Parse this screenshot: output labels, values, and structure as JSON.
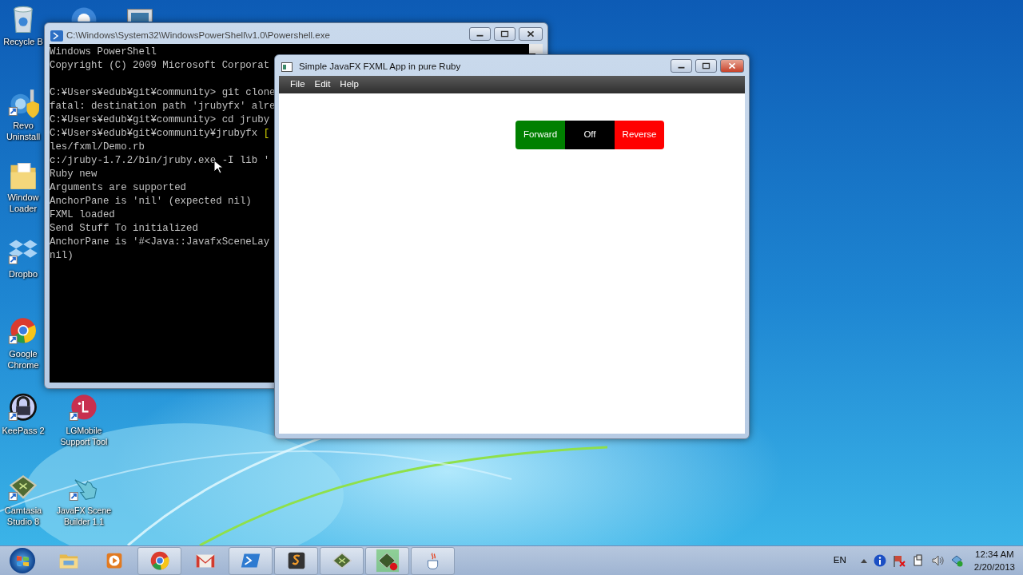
{
  "desktop_icons": [
    {
      "kind": "recycle",
      "label": "Recycle B"
    },
    {
      "kind": "revo",
      "label": "Revo Uninstall"
    },
    {
      "kind": "folder",
      "label": "Window Loader"
    },
    {
      "kind": "dropbox",
      "label": "Dropbo"
    },
    {
      "kind": "chrome",
      "label": "Google Chrome"
    },
    {
      "kind": "keepass",
      "label": "KeePass 2"
    },
    {
      "kind": "camtasia",
      "label": "Camtasia Studio 8"
    },
    {
      "kind": "ie"
    },
    {
      "kind": "lg",
      "label": "LGMobile Support Tool"
    },
    {
      "kind": "hand",
      "label": "JavaFX Scene Builder 1.1"
    },
    {
      "kind": "monitor"
    }
  ],
  "console_window": {
    "title": "C:\\Windows\\System32\\WindowsPowerShell\\v1.0\\Powershell.exe",
    "lines": [
      {
        "text": "Windows PowerShell"
      },
      {
        "text": "Copyright (C) 2009 Microsoft Corporat"
      },
      {
        "text": "C:¥Users¥edub¥git¥community> git clone",
        "blank_before": true
      },
      {
        "text": "fatal: destination path 'jrubyfx' alre"
      },
      {
        "text": "C:¥Users¥edub¥git¥community> cd jruby"
      },
      {
        "text": "C:¥Users¥edub¥git¥community¥jrubyfx",
        "tail": "["
      },
      {
        "text": "les/fxml/Demo.rb"
      },
      {
        "text": "c:/jruby-1.7.2/bin/jruby.exe -I lib '"
      },
      {
        "text": "Ruby new"
      },
      {
        "text": "Arguments are supported"
      },
      {
        "text": "AnchorPane is 'nil' (expected nil)"
      },
      {
        "text": "FXML loaded"
      },
      {
        "text": "Send Stuff To initialized"
      },
      {
        "text": "AnchorPane is '#<Java::JavafxSceneLay"
      },
      {
        "text": "nil)"
      }
    ]
  },
  "app_window": {
    "title": "Simple JavaFX FXML App in pure Ruby",
    "menu": [
      "File",
      "Edit",
      "Help"
    ],
    "segments": [
      {
        "label": "Forward",
        "color": "#008000"
      },
      {
        "label": "Off",
        "color": "#000000"
      },
      {
        "label": "Reverse",
        "color": "#ff0000"
      }
    ]
  },
  "taskbar": {
    "items": [
      {
        "kind": "explorer",
        "running": false
      },
      {
        "kind": "media",
        "running": false
      },
      {
        "kind": "chrome",
        "running": true
      },
      {
        "kind": "gmail",
        "running": false
      },
      {
        "kind": "powershell",
        "running": true
      },
      {
        "kind": "sublime",
        "running": true
      },
      {
        "kind": "camtasia",
        "running": true
      },
      {
        "kind": "recorder",
        "running": true
      },
      {
        "kind": "java",
        "running": true
      }
    ],
    "language": "EN",
    "tray": [
      {
        "kind": "info"
      },
      {
        "kind": "flag"
      },
      {
        "kind": "device"
      },
      {
        "kind": "volume"
      },
      {
        "kind": "network"
      }
    ],
    "time": "12:34 AM",
    "date": "2/20/2013"
  }
}
